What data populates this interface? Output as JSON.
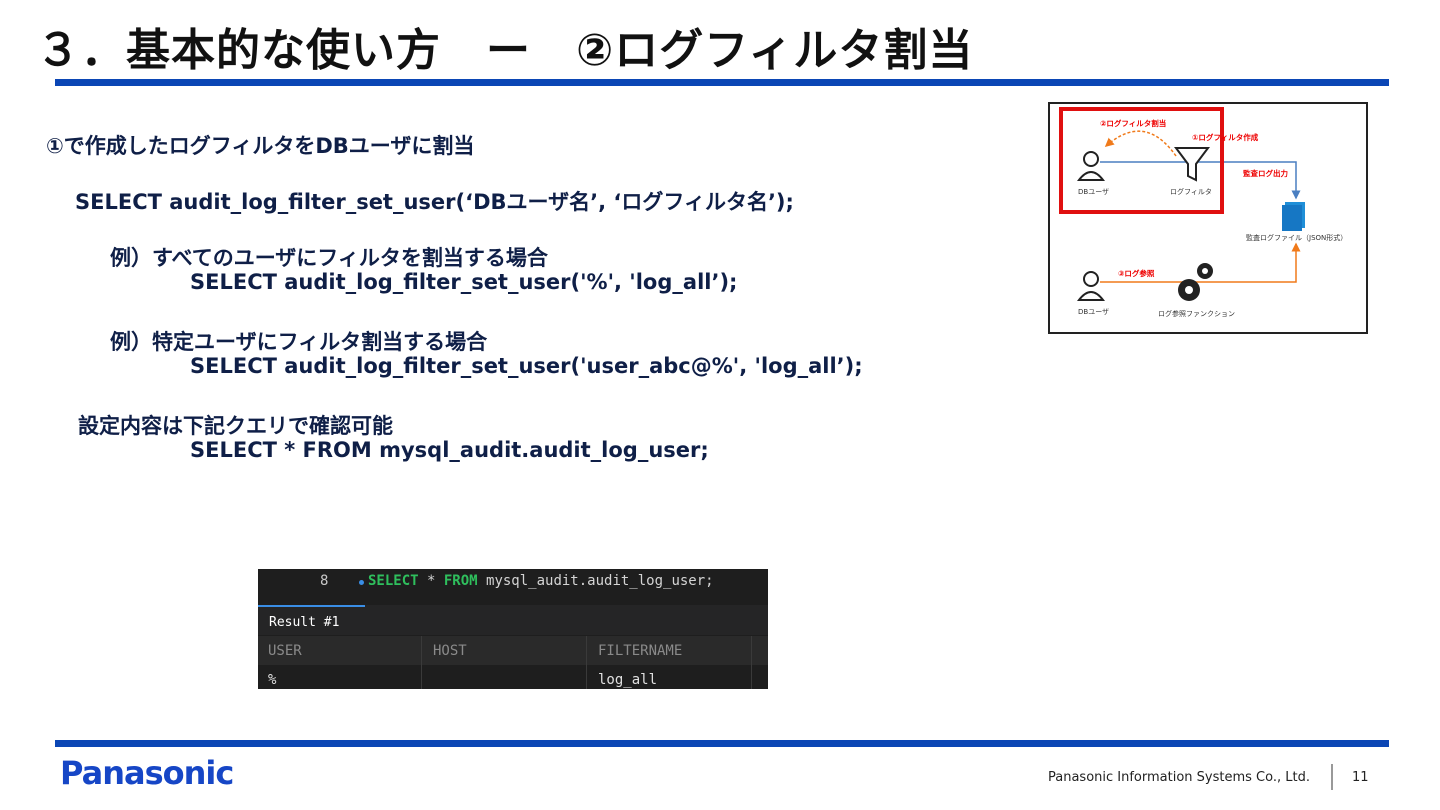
{
  "slide": {
    "title": "３．基本的な使い方　ー　②ログフィルタ割当",
    "lines": {
      "heading": "①で作成したログフィルタをDBユーザに割当",
      "syntax": "SELECT audit_log_filter_set_user(‘DBユーザ名’, ‘ログフィルタ名’);",
      "example1_label": "例）すべてのユーザにフィルタを割当する場合",
      "example1_sql": "SELECT audit_log_filter_set_user('%', 'log_all’);",
      "example2_label": "例）特定ユーザにフィルタ割当する場合",
      "example2_sql": "SELECT audit_log_filter_set_user('user_abc@%', 'log_all’);",
      "check_label": "設定内容は下記クエリで確認可能",
      "check_sql": "SELECT * FROM mysql_audit.audit_log_user;"
    }
  },
  "diagram": {
    "label_assign": "②ログフィルタ割当",
    "label_create": "①ログフィルタ作成",
    "label_output": "監査ログ出力",
    "label_ref": "③ログ参照",
    "user_top": "DBユーザ",
    "filter": "ログフィルタ",
    "audit_file": "監査ログファイル（JSON形式）",
    "user_bottom": "DBユーザ",
    "ref_function": "ログ参照ファンクション"
  },
  "editor": {
    "line_number": "8",
    "sql_kw1": "SELECT",
    "sql_mid": " * ",
    "sql_kw2": "FROM",
    "sql_rest": " mysql_audit.audit_log_user;",
    "result_tab": "Result #1",
    "columns": [
      "USER",
      "HOST",
      "FILTERNAME"
    ],
    "row": [
      "%",
      "",
      "log_all"
    ]
  },
  "footer": {
    "logo": "Panasonic",
    "company": "Panasonic Information Systems Co., Ltd.",
    "page": "11"
  },
  "colors": {
    "accent": "#0b46b5",
    "highlight": "#e01010",
    "orange": "#f07a1a"
  }
}
